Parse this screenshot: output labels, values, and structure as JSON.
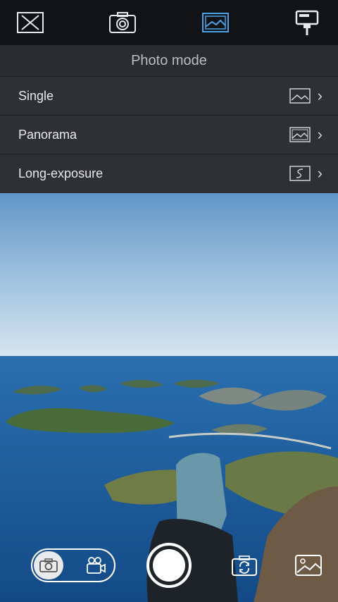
{
  "toolbar": {
    "icons": [
      "close-box-icon",
      "camera-icon",
      "landscape-icon",
      "selfie-stick-icon"
    ],
    "active_color": "#4aa3e8"
  },
  "menu": {
    "title": "Photo mode",
    "items": [
      {
        "label": "Single",
        "icon": "single-photo-icon"
      },
      {
        "label": "Panorama",
        "icon": "panorama-icon"
      },
      {
        "label": "Long-exposure",
        "icon": "long-exposure-icon"
      }
    ]
  },
  "controls": {
    "modes": [
      "photo",
      "video"
    ],
    "selected_mode": "photo",
    "icons": [
      "camera-icon",
      "video-camera-icon",
      "shutter-button",
      "switch-camera-icon",
      "gallery-icon"
    ]
  }
}
